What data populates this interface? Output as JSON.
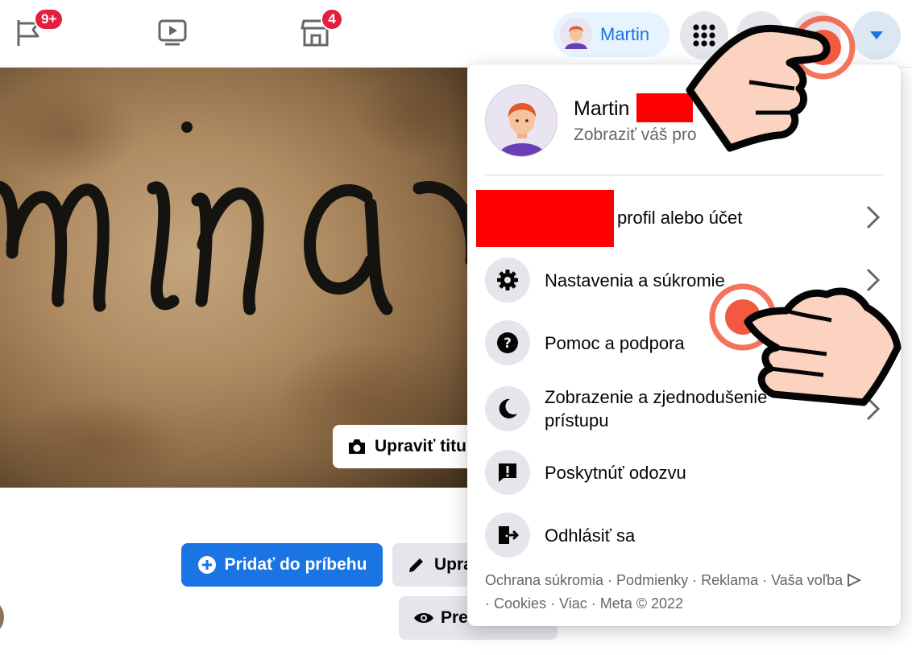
{
  "topbar": {
    "pages_badge": "9+",
    "marketplace_badge": "4",
    "profile_name": "Martin"
  },
  "cover": {
    "edit_label": "Upraviť titu",
    "script_text": "mina"
  },
  "profile_actions": {
    "add_story_label": "Pridať do príbehu",
    "edit_profile_label": "Upra",
    "view_as_label": "Pre"
  },
  "menu": {
    "name": "Martin",
    "view_profile": "Zobraziť váš pro",
    "items": [
      {
        "label": "profil alebo účet",
        "icon": "switch-profile-icon",
        "chevron": true
      },
      {
        "label": "Nastavenia a súkromie",
        "icon": "gear-icon",
        "chevron": true
      },
      {
        "label": "Pomoc a podpora",
        "icon": "help-icon",
        "chevron": false
      },
      {
        "label": "Zobrazenie a zjednodušenie prístupu",
        "icon": "moon-icon",
        "chevron": true
      },
      {
        "label": "Poskytnúť odozvu",
        "icon": "feedback-icon",
        "chevron": false
      },
      {
        "label": "Odhlásiť sa",
        "icon": "logout-icon",
        "chevron": false
      }
    ],
    "footer_line1": "Ochrana súkromia · Podmienky · Reklama · Vaša voľba",
    "footer_line2": "· Cookies · Viac · Meta © 2022"
  },
  "colors": {
    "accent": "#1b74e4",
    "badge": "#e41e3f",
    "redaction": "#ff0000",
    "pointer_ring": "#f15a3f",
    "hand_skin": "#fbd3c0"
  }
}
